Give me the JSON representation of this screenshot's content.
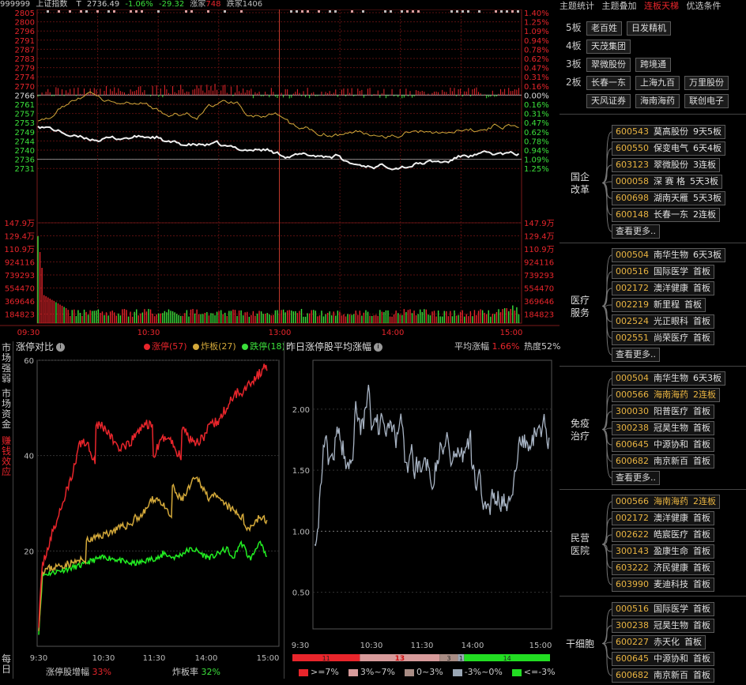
{
  "header": {
    "code": "999999",
    "name": "上证指数",
    "t_label": "T",
    "price": "2736.49",
    "pct": "-1.06%",
    "chg": "-29.32",
    "up_label": "涨家",
    "up_count": "748",
    "down_label": "跌家",
    "down_count": "1406"
  },
  "price_axis": {
    "left": [
      "2805",
      "2800",
      "2796",
      "2791",
      "2787",
      "2783",
      "2779",
      "2774",
      "2770",
      "2766",
      "2761",
      "2757",
      "2753",
      "2749",
      "2744",
      "2740",
      "2736",
      "2731"
    ],
    "right": [
      "1.40%",
      "1.25%",
      "1.09%",
      "0.94%",
      "0.78%",
      "0.62%",
      "0.47%",
      "0.31%",
      "0.16%",
      "0.00%",
      "0.16%",
      "0.31%",
      "0.47%",
      "0.62%",
      "0.78%",
      "0.94%",
      "1.09%",
      "1.25%"
    ]
  },
  "volume_axis": {
    "left": [
      "147.9万",
      "129.4万",
      "110.9万",
      "924116",
      "739293",
      "554470",
      "369646",
      "184823"
    ],
    "right": [
      "147.9万",
      "129.4万",
      "110.9万",
      "924116",
      "739293",
      "554470",
      "369646",
      "184823"
    ]
  },
  "time_axis": [
    "09:30",
    "10:30",
    "13:00",
    "14:00",
    "15:00"
  ],
  "right_panel": {
    "tabs": [
      "主题统计",
      "主题叠加",
      "连板天梯",
      "优选条件"
    ],
    "boards": [
      {
        "level": "5板",
        "stocks": [
          "老百姓",
          "日发精机"
        ]
      },
      {
        "level": "4板",
        "stocks": [
          "天茂集团"
        ]
      },
      {
        "level": "3板",
        "stocks": [
          "翠微股份",
          "跨境通"
        ]
      },
      {
        "level": "2板",
        "stocks": [
          "长春一东",
          "上海九百",
          "万里股份"
        ]
      },
      {
        "level": "",
        "stocks": [
          "天风证券",
          "海南海药",
          "联创电子"
        ]
      }
    ],
    "groups": [
      {
        "label": "国企改革",
        "items": [
          {
            "code": "600543",
            "name": "莫高股份",
            "tag": "9天5板",
            "hl": false
          },
          {
            "code": "600550",
            "name": "保变电气",
            "tag": "6天4板",
            "hl": false
          },
          {
            "code": "603123",
            "name": "翠微股份",
            "tag": "3连板",
            "hl": false
          },
          {
            "code": "000058",
            "name": "深 赛 格",
            "tag": "5天3板",
            "hl": false
          },
          {
            "code": "600698",
            "name": "湖南天雁",
            "tag": "5天3板",
            "hl": false
          },
          {
            "code": "600148",
            "name": "长春一东",
            "tag": "2连板",
            "hl": false
          }
        ],
        "more": "查看更多.."
      },
      {
        "label": "医疗服务",
        "items": [
          {
            "code": "000504",
            "name": "南华生物",
            "tag": "6天3板",
            "hl": false
          },
          {
            "code": "000516",
            "name": "国际医学",
            "tag": "首板",
            "hl": false
          },
          {
            "code": "002172",
            "name": "澳洋健康",
            "tag": "首板",
            "hl": false
          },
          {
            "code": "002219",
            "name": "新里程",
            "tag": "首板",
            "hl": false
          },
          {
            "code": "002524",
            "name": "光正眼科",
            "tag": "首板",
            "hl": false
          },
          {
            "code": "002551",
            "name": "尚荣医疗",
            "tag": "首板",
            "hl": false
          }
        ],
        "more": "查看更多.."
      },
      {
        "label": "免疫治疗",
        "items": [
          {
            "code": "000504",
            "name": "南华生物",
            "tag": "6天3板",
            "hl": false
          },
          {
            "code": "000566",
            "name": "海南海药",
            "tag": "2连板",
            "hl": true
          },
          {
            "code": "300030",
            "name": "阳普医疗",
            "tag": "首板",
            "hl": false
          },
          {
            "code": "300238",
            "name": "冠昊生物",
            "tag": "首板",
            "hl": false
          },
          {
            "code": "600645",
            "name": "中源协和",
            "tag": "首板",
            "hl": false
          },
          {
            "code": "600682",
            "name": "南京新百",
            "tag": "首板",
            "hl": false
          }
        ],
        "more": "查看更多.."
      },
      {
        "label": "民营医院",
        "items": [
          {
            "code": "000566",
            "name": "海南海药",
            "tag": "2连板",
            "hl": true
          },
          {
            "code": "002172",
            "name": "澳洋健康",
            "tag": "首板",
            "hl": false
          },
          {
            "code": "002622",
            "name": "皓宸医疗",
            "tag": "首板",
            "hl": false
          },
          {
            "code": "300143",
            "name": "盈康生命",
            "tag": "首板",
            "hl": false
          },
          {
            "code": "603222",
            "name": "济民健康",
            "tag": "首板",
            "hl": false
          },
          {
            "code": "603990",
            "name": "麦迪科技",
            "tag": "首板",
            "hl": false
          }
        ],
        "more": ""
      },
      {
        "label": "干细胞",
        "items": [
          {
            "code": "000516",
            "name": "国际医学",
            "tag": "首板",
            "hl": false
          },
          {
            "code": "300238",
            "name": "冠昊生物",
            "tag": "首板",
            "hl": false
          },
          {
            "code": "600227",
            "name": "赤天化",
            "tag": "首板",
            "hl": false
          },
          {
            "code": "600645",
            "name": "中源协和",
            "tag": "首板",
            "hl": false
          },
          {
            "code": "600682",
            "name": "南京新百",
            "tag": "首板",
            "hl": false
          }
        ],
        "more": ""
      }
    ]
  },
  "side_tabs": [
    "市场强弱",
    "市场资金",
    "赚钱效应",
    "每日"
  ],
  "panel_left": {
    "title": "涨停对比",
    "legend": [
      {
        "label": "涨停",
        "count": "(57)",
        "color": "#e8252b"
      },
      {
        "label": "炸板",
        "count": "(27)",
        "color": "#d4a93a"
      },
      {
        "label": "跌停",
        "count": "(18)",
        "color": "#3be03b"
      }
    ],
    "yticks": [
      "60",
      "40",
      "20"
    ],
    "xticks": [
      "9:30",
      "10:30",
      "11:30",
      "14:00",
      "15:00"
    ],
    "footer": [
      {
        "label": "涨停股增幅",
        "value": "33%"
      },
      {
        "label": "炸板率",
        "value": "32%"
      }
    ]
  },
  "panel_right": {
    "title": "昨日涨停股平均涨幅",
    "avg_label": "平均涨幅",
    "avg_value": "1.66%",
    "heat_label": "热度52%",
    "yticks": [
      "2.00",
      "1.50",
      "1.00",
      "0.50"
    ],
    "xticks": [
      "9:30",
      "10:30",
      "11:30",
      "14:00",
      "15:00"
    ],
    "bar_values": [
      "11",
      "13",
      "3",
      "1",
      "14"
    ],
    "legend": [
      {
        "label": ">=7%",
        "color": "#e8252b"
      },
      {
        "label": "3%~7%",
        "color": "#d79a9a"
      },
      {
        "label": "0~3%",
        "color": "#a88c84"
      },
      {
        "label": "-3%~0%",
        "color": "#9aa7b5"
      },
      {
        "label": "<=-3%",
        "color": "#22dd22"
      }
    ]
  },
  "colors": {
    "red": "#e8252b",
    "green": "#22dd22",
    "yellow": "#d4a93a",
    "white": "#f0f0f0",
    "grid": "#6b1212"
  }
}
